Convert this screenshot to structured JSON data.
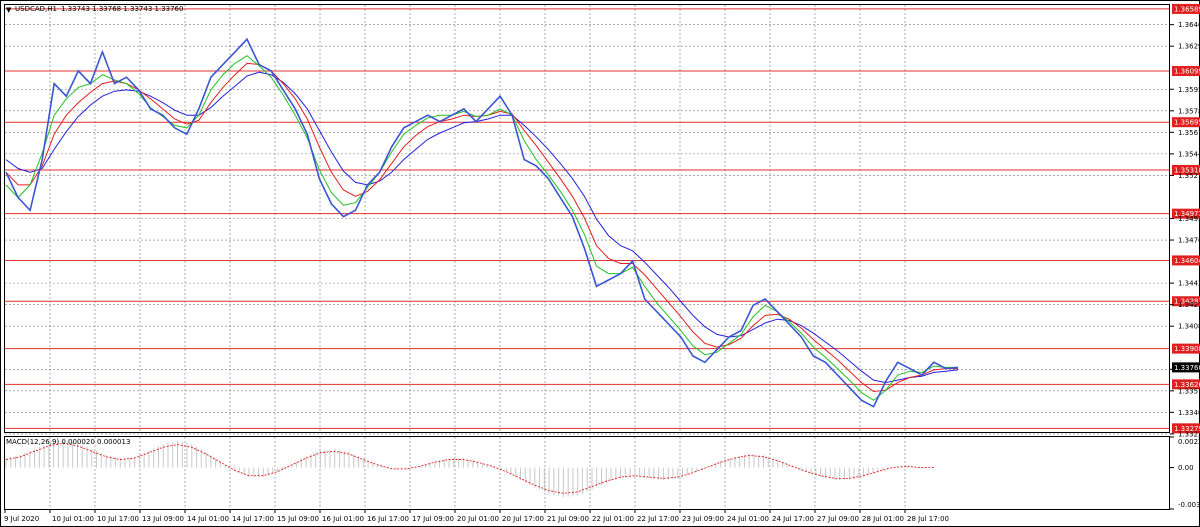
{
  "window": {
    "title": "USDCAD,H1",
    "ohlc": "1.33743 1.33768 1.33743 1.33760",
    "menu_icon": "dropdown-triangle-icon"
  },
  "indicator": {
    "label": "MACD(12,26,9) 0.000020 0.000013",
    "ticks": [
      "0.00226",
      "0.00",
      "-0.00306"
    ]
  },
  "colors": {
    "price": "#3a56d4",
    "ma_fast": "#22c022",
    "ma_mid": "#e02020",
    "ma_slow": "#2222dd",
    "level_line": "#e03030",
    "level_tag_bg": "#e02020",
    "current_tag_bg": "#000000",
    "grid": "#7a7a7a",
    "histogram": "#c8c8c8",
    "signal": "#e02020"
  },
  "chart_data": {
    "type": "line",
    "symbol": "USDCAD",
    "timeframe": "H1",
    "ylim": [
      1.3325,
      1.3662
    ],
    "y_ticks": [
      "1.36465",
      "1.36295",
      "1.35955",
      "1.35785",
      "1.35615",
      "1.35445",
      "1.35275",
      "1.34935",
      "1.34765",
      "1.34425",
      "1.34255",
      "1.34085",
      "1.33745",
      "1.33575",
      "1.33405",
      "1.33235"
    ],
    "x_labels": [
      "9 Jul 2020",
      "10 Jul 01:00",
      "10 Jul 17:00",
      "13 Jul 09:00",
      "14 Jul 01:00",
      "14 Jul 17:00",
      "15 Jul 09:00",
      "16 Jul 01:00",
      "16 Jul 17:00",
      "17 Jul 09:00",
      "20 Jul 01:00",
      "20 Jul 17:00",
      "21 Jul 09:00",
      "22 Jul 01:00",
      "22 Jul 17:00",
      "23 Jul 09:00",
      "24 Jul 01:00",
      "24 Jul 17:00",
      "27 Jul 09:00",
      "28 Jul 01:00",
      "28 Jul 17:00"
    ],
    "horizontal_levels": [
      "1.36589",
      "1.36099",
      "1.35695",
      "1.35318",
      "1.34973",
      "1.34604",
      "1.34282",
      "1.33908",
      "1.33626",
      "1.33279"
    ],
    "current_price": "1.33760",
    "series": [
      {
        "values": [
          1.353,
          1.351,
          1.35,
          1.354,
          1.36,
          1.359,
          1.361,
          1.36,
          1.3625,
          1.36,
          1.3605,
          1.3595,
          1.358,
          1.3575,
          1.3565,
          1.356,
          1.358,
          1.3605,
          1.3615,
          1.3625,
          1.3635,
          1.3615,
          1.361,
          1.3595,
          1.358,
          1.356,
          1.3525,
          1.3505,
          1.3495,
          1.35,
          1.352,
          1.353,
          1.355,
          1.3565,
          1.357,
          1.3575,
          1.357,
          1.3575,
          1.358,
          1.357,
          1.358,
          1.359,
          1.3575,
          1.354,
          1.3535,
          1.3525,
          1.351,
          1.3495,
          1.347,
          1.344,
          1.3445,
          1.345,
          1.346,
          1.343,
          1.342,
          1.341,
          1.34,
          1.3385,
          1.338,
          1.339,
          1.34,
          1.3405,
          1.3425,
          1.343,
          1.342,
          1.341,
          1.34,
          1.3385,
          1.338,
          1.337,
          1.336,
          1.335,
          1.3345,
          1.3365,
          1.338,
          1.3375,
          1.337,
          1.338,
          1.3375,
          1.3376
        ]
      },
      {
        "name": "",
        "values": [
          1.352,
          1.351,
          1.352,
          1.3545,
          1.3575,
          1.3588,
          1.3597,
          1.36,
          1.3607,
          1.3603,
          1.36,
          1.3592,
          1.3581,
          1.3574,
          1.3567,
          1.3565,
          1.3575,
          1.3595,
          1.3607,
          1.3616,
          1.3622,
          1.3614,
          1.3605,
          1.3591,
          1.3575,
          1.3557,
          1.3532,
          1.3514,
          1.3504,
          1.3506,
          1.3518,
          1.353,
          1.3546,
          1.356,
          1.3567,
          1.3573,
          1.3575,
          1.3575,
          1.3578,
          1.3574,
          1.3575,
          1.358,
          1.3575,
          1.3555,
          1.354,
          1.3528,
          1.3515,
          1.35,
          1.3481,
          1.3456,
          1.345,
          1.345,
          1.3455,
          1.344,
          1.3427,
          1.3416,
          1.3405,
          1.3393,
          1.3386,
          1.3388,
          1.3395,
          1.3402,
          1.3416,
          1.3425,
          1.342,
          1.3412,
          1.3403,
          1.3392,
          1.3384,
          1.3375,
          1.3366,
          1.3356,
          1.335,
          1.3358,
          1.337,
          1.3373,
          1.3372,
          1.3377,
          1.3376,
          1.3376
        ]
      },
      {
        "name": "",
        "values": [
          1.353,
          1.352,
          1.352,
          1.3535,
          1.356,
          1.3575,
          1.3585,
          1.3593,
          1.36,
          1.3602,
          1.36,
          1.3595,
          1.3588,
          1.358,
          1.3572,
          1.3568,
          1.3571,
          1.3585,
          1.3597,
          1.3607,
          1.3616,
          1.3615,
          1.361,
          1.36,
          1.3588,
          1.3572,
          1.355,
          1.353,
          1.3516,
          1.3511,
          1.3515,
          1.3524,
          1.3537,
          1.355,
          1.3559,
          1.3566,
          1.357,
          1.3572,
          1.3575,
          1.3574,
          1.3575,
          1.3578,
          1.3576,
          1.3563,
          1.3551,
          1.3538,
          1.3525,
          1.3511,
          1.3494,
          1.3472,
          1.3462,
          1.3458,
          1.3458,
          1.3449,
          1.3438,
          1.3427,
          1.3416,
          1.3404,
          1.3395,
          1.3392,
          1.3394,
          1.3399,
          1.3409,
          1.3417,
          1.3418,
          1.3414,
          1.3407,
          1.3398,
          1.339,
          1.3382,
          1.3373,
          1.3364,
          1.3357,
          1.3358,
          1.3364,
          1.3368,
          1.337,
          1.3374,
          1.3375,
          1.3375
        ]
      },
      {
        "name": "",
        "values": [
          1.354,
          1.3533,
          1.353,
          1.3533,
          1.3548,
          1.3562,
          1.3574,
          1.3583,
          1.359,
          1.3594,
          1.3595,
          1.3594,
          1.359,
          1.3585,
          1.3579,
          1.3575,
          1.3575,
          1.3581,
          1.359,
          1.3598,
          1.3606,
          1.3609,
          1.3607,
          1.3601,
          1.3592,
          1.358,
          1.3563,
          1.3546,
          1.3531,
          1.3522,
          1.352,
          1.3523,
          1.353,
          1.354,
          1.3548,
          1.3556,
          1.3561,
          1.3565,
          1.3569,
          1.357,
          1.3572,
          1.3575,
          1.3575,
          1.3567,
          1.3558,
          1.3548,
          1.3537,
          1.3525,
          1.3511,
          1.3493,
          1.348,
          1.3472,
          1.3468,
          1.3459,
          1.3449,
          1.3439,
          1.3428,
          1.3417,
          1.3408,
          1.3402,
          1.34,
          1.3401,
          1.3406,
          1.3411,
          1.3414,
          1.3413,
          1.3409,
          1.3403,
          1.3396,
          1.3389,
          1.3381,
          1.3373,
          1.3366,
          1.3364,
          1.3366,
          1.3368,
          1.3369,
          1.3372,
          1.3373,
          1.3374
        ]
      }
    ],
    "macd_signal": [
      0.0006,
      0.0008,
      0.0012,
      0.0016,
      0.0018,
      0.0016,
      0.0012,
      0.0008,
      0.0006,
      0.0007,
      0.0011,
      0.0015,
      0.0017,
      0.0015,
      0.001,
      0.0004,
      -0.0002,
      -0.0006,
      -0.0006,
      -0.0003,
      0.0002,
      0.0007,
      0.0011,
      0.0012,
      0.001,
      0.0006,
      0.0002,
      -0.0001,
      -0.0001,
      0.0001,
      0.0004,
      0.0006,
      0.0006,
      0.0004,
      0.0001,
      -0.0003,
      -0.0008,
      -0.0013,
      -0.0017,
      -0.0019,
      -0.0018,
      -0.0014,
      -0.001,
      -0.0007,
      -0.0006,
      -0.0007,
      -0.0008,
      -0.0007,
      -0.0004,
      0.0,
      0.0004,
      0.0007,
      0.0009,
      0.0008,
      0.0005,
      0.0001,
      -0.0003,
      -0.0006,
      -0.0008,
      -0.0008,
      -0.0006,
      -0.0003,
      0.0,
      0.0001,
      0.0,
      0.0
    ]
  }
}
